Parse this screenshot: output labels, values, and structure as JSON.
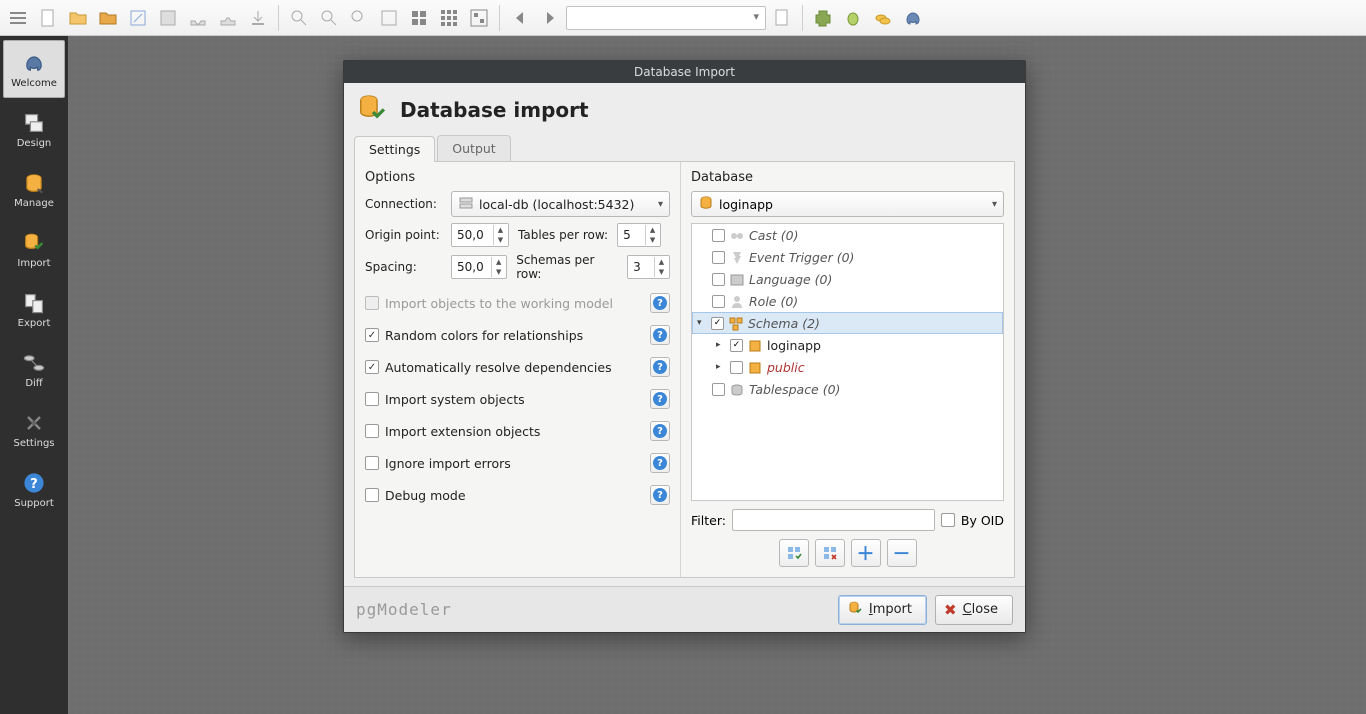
{
  "sidebar": {
    "items": [
      {
        "label": "Welcome"
      },
      {
        "label": "Design"
      },
      {
        "label": "Manage"
      },
      {
        "label": "Import"
      },
      {
        "label": "Export"
      },
      {
        "label": "Diff"
      },
      {
        "label": "Settings"
      },
      {
        "label": "Support"
      }
    ]
  },
  "dialog": {
    "window_title": "Database Import",
    "header": "Database import",
    "tabs": {
      "settings": "Settings",
      "output": "Output"
    },
    "options_heading": "Options",
    "database_heading": "Database",
    "labels": {
      "connection": "Connection:",
      "origin_point": "Origin point:",
      "tables_per_row": "Tables per row:",
      "spacing": "Spacing:",
      "schemas_per_row": "Schemas per row:"
    },
    "values": {
      "connection": "local-db (localhost:5432)",
      "origin_point": "50,0",
      "tables_per_row": "5",
      "spacing": "50,0",
      "schemas_per_row": "3",
      "database": "loginapp"
    },
    "checkboxes": {
      "import_to_working": "Import objects to the working model",
      "random_colors": "Random colors for relationships",
      "auto_resolve": "Automatically resolve dependencies",
      "import_system": "Import system objects",
      "import_extension": "Import extension objects",
      "ignore_errors": "Ignore import errors",
      "debug": "Debug mode"
    },
    "tree": {
      "cast": "Cast (0)",
      "event_trigger": "Event Trigger (0)",
      "language": "Language (0)",
      "role": "Role (0)",
      "schema": "Schema (2)",
      "schema_loginapp": "loginapp",
      "schema_public": "public",
      "tablespace": "Tablespace (0)"
    },
    "filter_label": "Filter:",
    "by_oid": "By OID",
    "buttons": {
      "import": "Import",
      "close": "Close"
    },
    "brand": "pgModeler"
  }
}
